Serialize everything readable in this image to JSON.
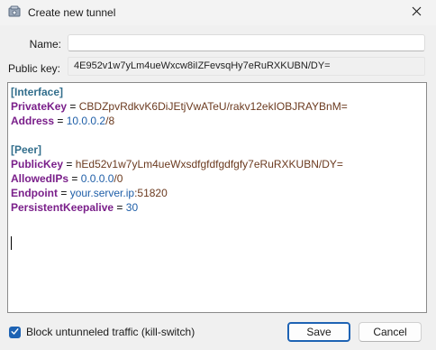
{
  "window": {
    "title": "Create new tunnel"
  },
  "form": {
    "name_label": "Name:",
    "name_value": "",
    "public_key_label": "Public key:",
    "public_key_value": "4E952v1w7yLm4ueWxcw8iIZFevsqHy7eRuRXKUBN/DY="
  },
  "config": {
    "interface_header": "[Interface]",
    "private_key_key": "PrivateKey",
    "private_key_value": "CBDZpvRdkvK6DiJEtjVwATeU/rakv12ekIOBJRAYBnM=",
    "address_key": "Address",
    "address_ip": "10.0.0.2",
    "address_mask": "8",
    "peer_header": "[Peer]",
    "public_key_key": "PublicKey",
    "public_key_value": "hEd52v1w7yLm4ueWxsdfgfdfgdfgfy7eRuRXKUBN/DY=",
    "allowed_ips_key": "AllowedIPs",
    "allowed_ips_ip": "0.0.0.0",
    "allowed_ips_mask": "0",
    "endpoint_key": "Endpoint",
    "endpoint_host": "your.server.ip",
    "endpoint_port": "51820",
    "keepalive_key": "PersistentKeepalive",
    "keepalive_value": "30",
    "eq": "=",
    "slash": "/",
    "colon": ":"
  },
  "footer": {
    "killswitch_label": "Block untunneled traffic (kill-switch)",
    "killswitch_checked": true,
    "save_label": "Save",
    "cancel_label": "Cancel"
  },
  "colors": {
    "accent": "#1e63b4",
    "section": "#326e8c",
    "key": "#7a1f8a",
    "string_value": "#6b3a1f",
    "number_value": "#1f5fa8"
  },
  "icons": {
    "app": "tunnel-app-icon",
    "close": "close-icon",
    "check": "checkmark-icon"
  }
}
